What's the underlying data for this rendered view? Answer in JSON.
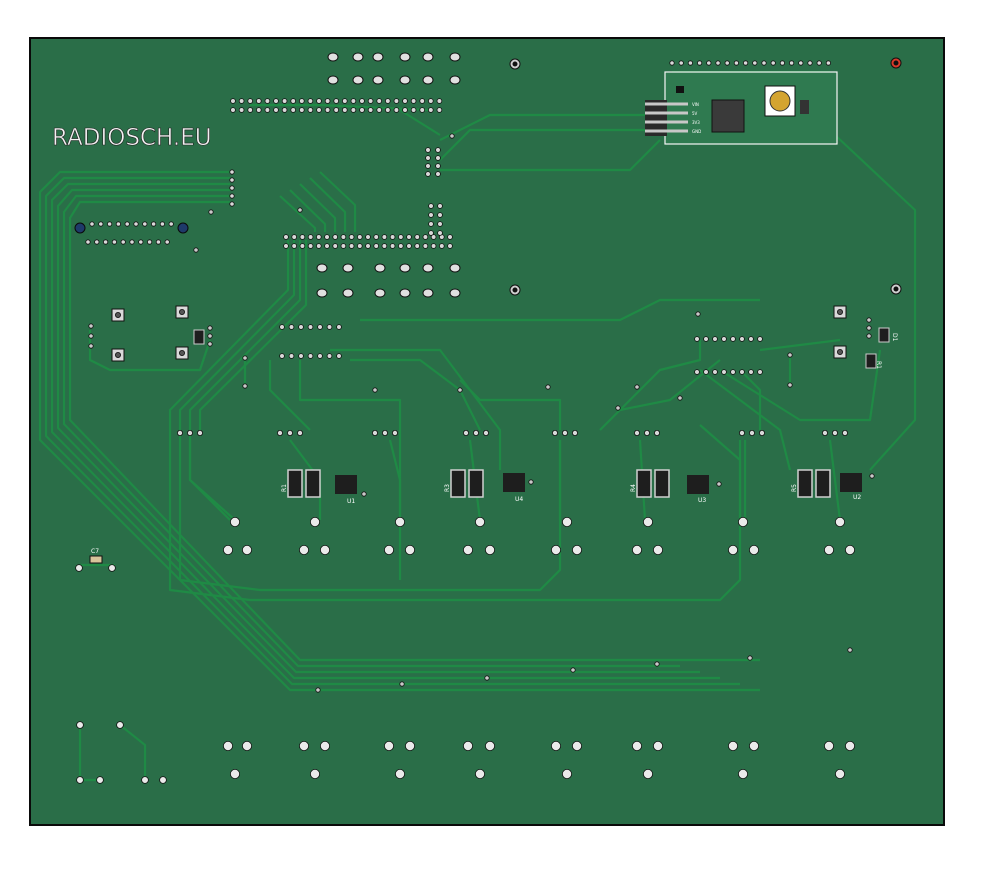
{
  "board": {
    "brand_text": "RADIOSCH.EU",
    "colors": {
      "background": "#ffffff",
      "board": "#2a6e48",
      "trace": "#1f8a45",
      "pad": "#d9d9d9",
      "hole": "#111111",
      "ic_body": "#1e1e1e",
      "smd_pad": "#d0d0d0"
    }
  },
  "labels": {
    "r1": "R1",
    "r3": "R3",
    "r4": "R4",
    "r5": "R5",
    "r_side": "R1",
    "u1": "U1",
    "u2": "U2",
    "u3": "U3",
    "u4": "U4",
    "c7": "C7",
    "d1": "D1",
    "pin_vin": "VIN",
    "pin_5v": "5V",
    "pin_3v3": "3V3",
    "pin_gnd": "GND"
  }
}
